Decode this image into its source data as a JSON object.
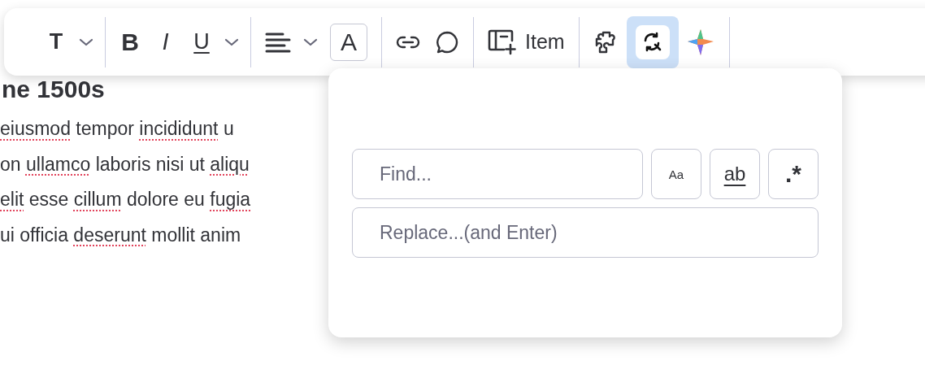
{
  "document": {
    "heading": "ne 1500s",
    "lines": [
      [
        {
          "text": "eiusmod",
          "misspelled": true
        },
        {
          "text": " tempor ",
          "misspelled": false
        },
        {
          "text": "incididunt",
          "misspelled": true
        },
        {
          "text": " u",
          "misspelled": false
        }
      ],
      [
        {
          "text": "on ",
          "misspelled": false
        },
        {
          "text": "ullamco",
          "misspelled": true
        },
        {
          "text": " laboris nisi ut ",
          "misspelled": false
        },
        {
          "text": "aliqu",
          "misspelled": true
        }
      ],
      [
        {
          "text": "elit",
          "misspelled": true
        },
        {
          "text": " esse ",
          "misspelled": false
        },
        {
          "text": "cillum",
          "misspelled": true
        },
        {
          "text": " dolore eu ",
          "misspelled": false
        },
        {
          "text": "fugia",
          "misspelled": true
        }
      ],
      [
        {
          "text": "ui officia ",
          "misspelled": false
        },
        {
          "text": "deserunt",
          "misspelled": true
        },
        {
          "text": " mollit anim",
          "misspelled": false
        }
      ]
    ]
  },
  "toolbar": [
    {
      "kind": "heading",
      "glyph": "T",
      "selected": false
    },
    {
      "kind": "caret",
      "selected": false
    },
    {
      "kind": "separator"
    },
    {
      "kind": "bold",
      "glyph": "B",
      "selected": false
    },
    {
      "kind": "italic",
      "glyph": "I",
      "selected": false
    },
    {
      "kind": "underline",
      "glyph": "U",
      "selected": false
    },
    {
      "kind": "caret",
      "selected": false
    },
    {
      "kind": "separator"
    },
    {
      "kind": "align",
      "selected": false
    },
    {
      "kind": "caret",
      "selected": false
    },
    {
      "kind": "color",
      "glyph": "A",
      "selected": false
    },
    {
      "kind": "separator"
    },
    {
      "kind": "link",
      "selected": false
    },
    {
      "kind": "comment",
      "selected": false
    },
    {
      "kind": "separator"
    },
    {
      "kind": "item",
      "label": "Item",
      "selected": false
    },
    {
      "kind": "separator"
    },
    {
      "kind": "puzzle",
      "selected": false
    },
    {
      "kind": "find-replace",
      "selected": true
    },
    {
      "kind": "sparkle",
      "selected": false
    },
    {
      "kind": "separator"
    }
  ],
  "find_replace": {
    "find": {
      "placeholder": "Find..."
    },
    "options": [
      {
        "kind": "match-case",
        "label": "Aa",
        "selected": false
      },
      {
        "kind": "whole-word",
        "label": "ab",
        "selected": false
      },
      {
        "kind": "regex",
        "label": ".*",
        "selected": false
      }
    ],
    "replace": {
      "placeholder": "Replace...(and Enter)"
    }
  }
}
